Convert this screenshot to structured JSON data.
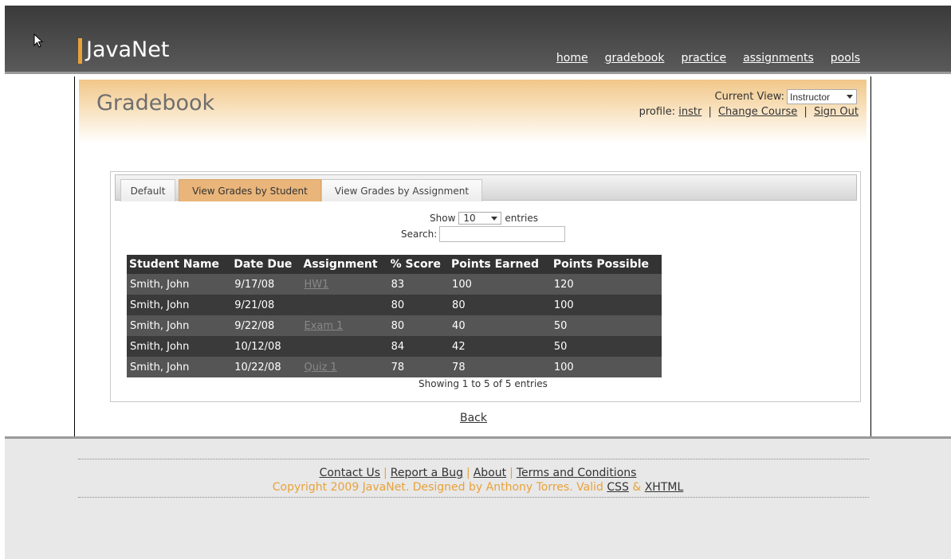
{
  "app": {
    "logo": "JavaNet"
  },
  "nav": {
    "items": [
      "home",
      "gradebook",
      "practice",
      "assignments",
      "pools"
    ]
  },
  "page": {
    "title": "Gradebook"
  },
  "view": {
    "label": "Current View:",
    "selected": "Instructor"
  },
  "profile": {
    "label": "profile:",
    "user": "instr",
    "change_course": "Change Course",
    "sign_out": "Sign Out",
    "separator": "|"
  },
  "tabs": [
    {
      "label": "Default",
      "active": false
    },
    {
      "label": "View Grades by Student",
      "active": true
    },
    {
      "label": "View Grades by Assignment",
      "active": false
    }
  ],
  "table_controls": {
    "show": "Show",
    "length": "10",
    "entries": "entries",
    "search_label": "Search:",
    "search_value": ""
  },
  "table": {
    "columns": [
      "Student Name",
      "Date Due",
      "Assignment",
      "% Score",
      "Points Earned",
      "Points Possible"
    ],
    "rows": [
      [
        "Smith, John",
        "9/17/08",
        "HW1",
        "83",
        "100",
        "120"
      ],
      [
        "Smith, John",
        "9/21/08",
        "",
        "80",
        "80",
        "100"
      ],
      [
        "Smith, John",
        "9/22/08",
        "Exam 1",
        "80",
        "40",
        "50"
      ],
      [
        "Smith, John",
        "10/12/08",
        "",
        "84",
        "42",
        "50"
      ],
      [
        "Smith, John",
        "10/22/08",
        "Quiz 1",
        "78",
        "78",
        "100"
      ]
    ],
    "info": "Showing 1 to 5 of 5 entries"
  },
  "back": "Back",
  "footer": {
    "links": [
      "Contact Us",
      "Report a Bug",
      "About",
      "Terms and Conditions"
    ],
    "link_separator": "|",
    "copyright_text": "Copyright 2009 JavaNet. Designed by Anthony Torres. Valid",
    "css": "CSS",
    "amp": "&",
    "xhtml": "XHTML"
  },
  "colors": {
    "accent": "#e8a23a",
    "header_bg": "#4a4a4a",
    "active_tab": "#e9b57a",
    "table_header": "#333333"
  }
}
